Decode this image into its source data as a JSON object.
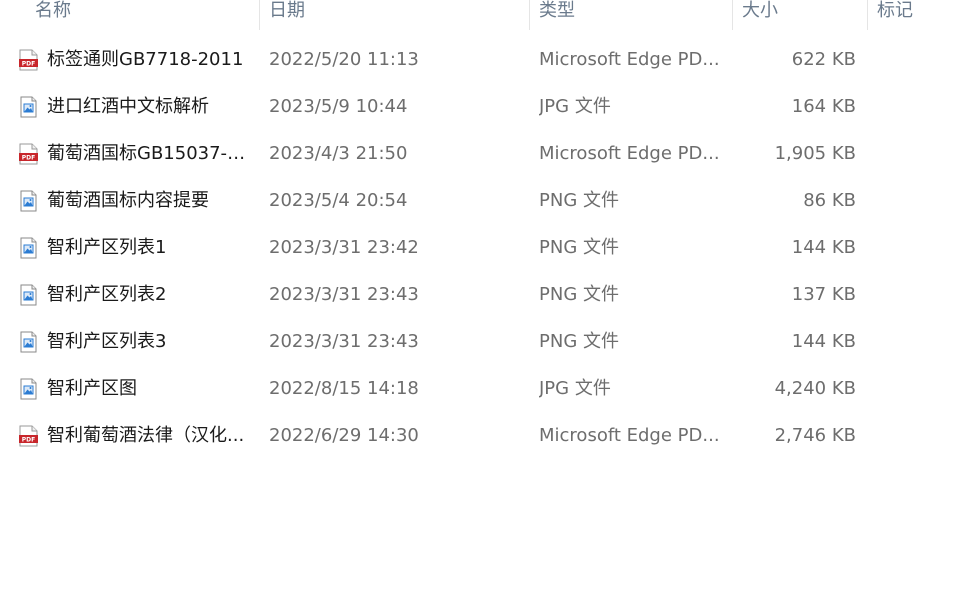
{
  "columns": {
    "name": "名称",
    "date": "日期",
    "type": "类型",
    "size": "大小",
    "tags": "标记"
  },
  "files": [
    {
      "name": "标签通则GB7718-2011",
      "date": "2022/5/20 11:13",
      "type": "Microsoft Edge PD...",
      "size": "622 KB",
      "icon": "pdf-file-icon"
    },
    {
      "name": "进口红酒中文标解析",
      "date": "2023/5/9 10:44",
      "type": "JPG 文件",
      "size": "164 KB",
      "icon": "image-file-icon"
    },
    {
      "name": "葡萄酒国标GB15037-2...",
      "date": "2023/4/3 21:50",
      "type": "Microsoft Edge PD...",
      "size": "1,905 KB",
      "icon": "pdf-file-icon"
    },
    {
      "name": "葡萄酒国标内容提要",
      "date": "2023/5/4 20:54",
      "type": "PNG 文件",
      "size": "86 KB",
      "icon": "image-file-icon"
    },
    {
      "name": "智利产区列表1",
      "date": "2023/3/31 23:42",
      "type": "PNG 文件",
      "size": "144 KB",
      "icon": "image-file-icon"
    },
    {
      "name": "智利产区列表2",
      "date": "2023/3/31 23:43",
      "type": "PNG 文件",
      "size": "137 KB",
      "icon": "image-file-icon"
    },
    {
      "name": "智利产区列表3",
      "date": "2023/3/31 23:43",
      "type": "PNG 文件",
      "size": "144 KB",
      "icon": "image-file-icon"
    },
    {
      "name": "智利产区图",
      "date": "2022/8/15 14:18",
      "type": "JPG 文件",
      "size": "4,240 KB",
      "icon": "image-file-icon"
    },
    {
      "name": "智利葡萄酒法律（汉化...",
      "date": "2022/6/29 14:30",
      "type": "Microsoft Edge PD...",
      "size": "2,746 KB",
      "icon": "pdf-file-icon"
    }
  ],
  "colors": {
    "header_text": "#6a7a8c",
    "name_text": "#1a1a1a",
    "meta_text": "#6d6d6d",
    "pdf_red": "#c8262b",
    "image_blue": "#2b7cd3"
  }
}
